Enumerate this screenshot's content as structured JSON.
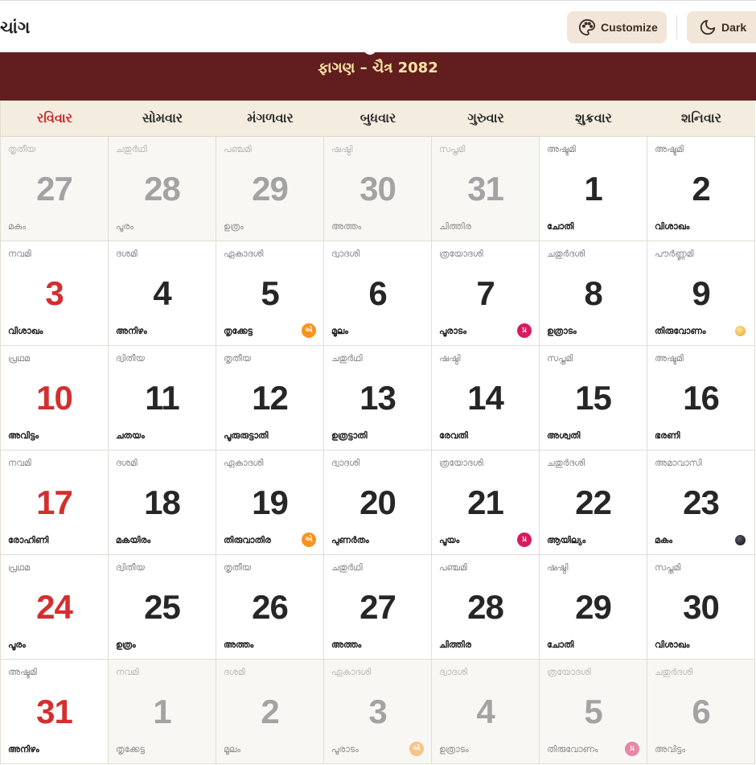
{
  "header": {
    "title": "ચાંગ",
    "customize_label": "Customize",
    "customize_icon": "palette-icon",
    "dark_label": "Dark",
    "dark_icon": "moon-icon"
  },
  "theme": {
    "month_bar_bg": "#621e1e",
    "month_title_color": "#fde6a8",
    "sunday_color": "#d32f2f",
    "ekadashi_badge": "#f7931e",
    "pradosh_badge": "#d81b60"
  },
  "calendar": {
    "month_title": "ફાગણ – ચૈત્ર 2082",
    "weekdays": [
      "રવિવાર",
      "સોમવાર",
      "મંગળવાર",
      "બુધવાર",
      "ગુરુવાર",
      "શુક્રવાર",
      "શનિવાર"
    ],
    "weeks": [
      [
        {
          "day": "27",
          "tithi": "തൃതീയ",
          "nakshatra": "മകം",
          "muted": true
        },
        {
          "day": "28",
          "tithi": "ചതുർഥി",
          "nakshatra": "പൂരം",
          "muted": true
        },
        {
          "day": "29",
          "tithi": "പഞ്ചമി",
          "nakshatra": "ഉത്രം",
          "muted": true
        },
        {
          "day": "30",
          "tithi": "ഷഷ്ഠി",
          "nakshatra": "അത്തം",
          "muted": true
        },
        {
          "day": "31",
          "tithi": "സപ്തമി",
          "nakshatra": "ചിത്തിര",
          "muted": true
        },
        {
          "day": "1",
          "tithi": "അഷ്ടമി",
          "nakshatra": "ചോതി"
        },
        {
          "day": "2",
          "tithi": "അഷ്ടമി",
          "nakshatra": "വിശാഖം"
        }
      ],
      [
        {
          "day": "3",
          "tithi": "നവമി",
          "nakshatra": "വിശാഖം"
        },
        {
          "day": "4",
          "tithi": "ദശമി",
          "nakshatra": "അനിഴം"
        },
        {
          "day": "5",
          "tithi": "ഏകാദശി",
          "nakshatra": "തൃക്കേട്ട",
          "badge": {
            "text": "એ",
            "color": "#f7931e"
          }
        },
        {
          "day": "6",
          "tithi": "ദ്വാദശി",
          "nakshatra": "മൂലം"
        },
        {
          "day": "7",
          "tithi": "ത്രയോദശി",
          "nakshatra": "പൂരാടം",
          "badge": {
            "text": "પ્ર",
            "color": "#d81b60"
          }
        },
        {
          "day": "8",
          "tithi": "ചതുർദശി",
          "nakshatra": "ഉത്രാടം"
        },
        {
          "day": "9",
          "tithi": "പൗർണ്ണമി",
          "nakshatra": "തിരുവോണം",
          "moon": "full-moon-icon"
        }
      ],
      [
        {
          "day": "10",
          "tithi": "പ്രഥമ",
          "nakshatra": "അവിട്ടം"
        },
        {
          "day": "11",
          "tithi": "ദ്വിതീയ",
          "nakshatra": "ചതയം"
        },
        {
          "day": "12",
          "tithi": "തൃതീയ",
          "nakshatra": "പൂരുരുട്ടാതി"
        },
        {
          "day": "13",
          "tithi": "ചതുർഥി",
          "nakshatra": "ഉത്രട്ടാതി"
        },
        {
          "day": "14",
          "tithi": "ഷഷ്ഠി",
          "nakshatra": "രേവതി"
        },
        {
          "day": "15",
          "tithi": "സപ്തമി",
          "nakshatra": "അശ്വതി"
        },
        {
          "day": "16",
          "tithi": "അഷ്ടമി",
          "nakshatra": "ഭരണി"
        }
      ],
      [
        {
          "day": "17",
          "tithi": "നവമി",
          "nakshatra": "രോഹിണി"
        },
        {
          "day": "18",
          "tithi": "ദശമി",
          "nakshatra": "മകയിരം"
        },
        {
          "day": "19",
          "tithi": "ഏകാദശി",
          "nakshatra": "തിരുവാതിര",
          "badge": {
            "text": "એ",
            "color": "#f7931e"
          }
        },
        {
          "day": "20",
          "tithi": "ദ്വാദശി",
          "nakshatra": "പുണർതം"
        },
        {
          "day": "21",
          "tithi": "ത്രയോദശി",
          "nakshatra": "പൂയം",
          "badge": {
            "text": "પ્ર",
            "color": "#d81b60"
          }
        },
        {
          "day": "22",
          "tithi": "ചതുർദശി",
          "nakshatra": "ആയില്യം"
        },
        {
          "day": "23",
          "tithi": "അമാവാസി",
          "nakshatra": "മകം",
          "moon": "new-moon-icon"
        }
      ],
      [
        {
          "day": "24",
          "tithi": "പ്രഥമ",
          "nakshatra": "പൂരം"
        },
        {
          "day": "25",
          "tithi": "ദ്വിതീയ",
          "nakshatra": "ഉത്രം"
        },
        {
          "day": "26",
          "tithi": "തൃതീയ",
          "nakshatra": "അത്തം"
        },
        {
          "day": "27",
          "tithi": "ചതുർഥി",
          "nakshatra": "അത്തം"
        },
        {
          "day": "28",
          "tithi": "പഞ്ചമി",
          "nakshatra": "ചിത്തിര"
        },
        {
          "day": "29",
          "tithi": "ഷഷ്ഠി",
          "nakshatra": "ചോതി"
        },
        {
          "day": "30",
          "tithi": "സപ്തമി",
          "nakshatra": "വിശാഖം"
        }
      ],
      [
        {
          "day": "31",
          "tithi": "അഷ്ടമി",
          "nakshatra": "അനിഴം"
        },
        {
          "day": "1",
          "tithi": "നവമി",
          "nakshatra": "തൃക്കേട്ട",
          "muted": true
        },
        {
          "day": "2",
          "tithi": "ദശമി",
          "nakshatra": "മൂലം",
          "muted": true
        },
        {
          "day": "3",
          "tithi": "ഏകാദശി",
          "nakshatra": "പൂരാടം",
          "muted": true,
          "badge": {
            "text": "એ",
            "color": "#f7931e"
          }
        },
        {
          "day": "4",
          "tithi": "ദ്വാദശി",
          "nakshatra": "ഉത്രാടം",
          "muted": true
        },
        {
          "day": "5",
          "tithi": "ത്രയോദശി",
          "nakshatra": "തിരുവോണം",
          "muted": true,
          "badge": {
            "text": "પ્ર",
            "color": "#d81b60"
          }
        },
        {
          "day": "6",
          "tithi": "ചതുർദശി",
          "nakshatra": "അവിട്ടം",
          "muted": true
        }
      ]
    ]
  }
}
